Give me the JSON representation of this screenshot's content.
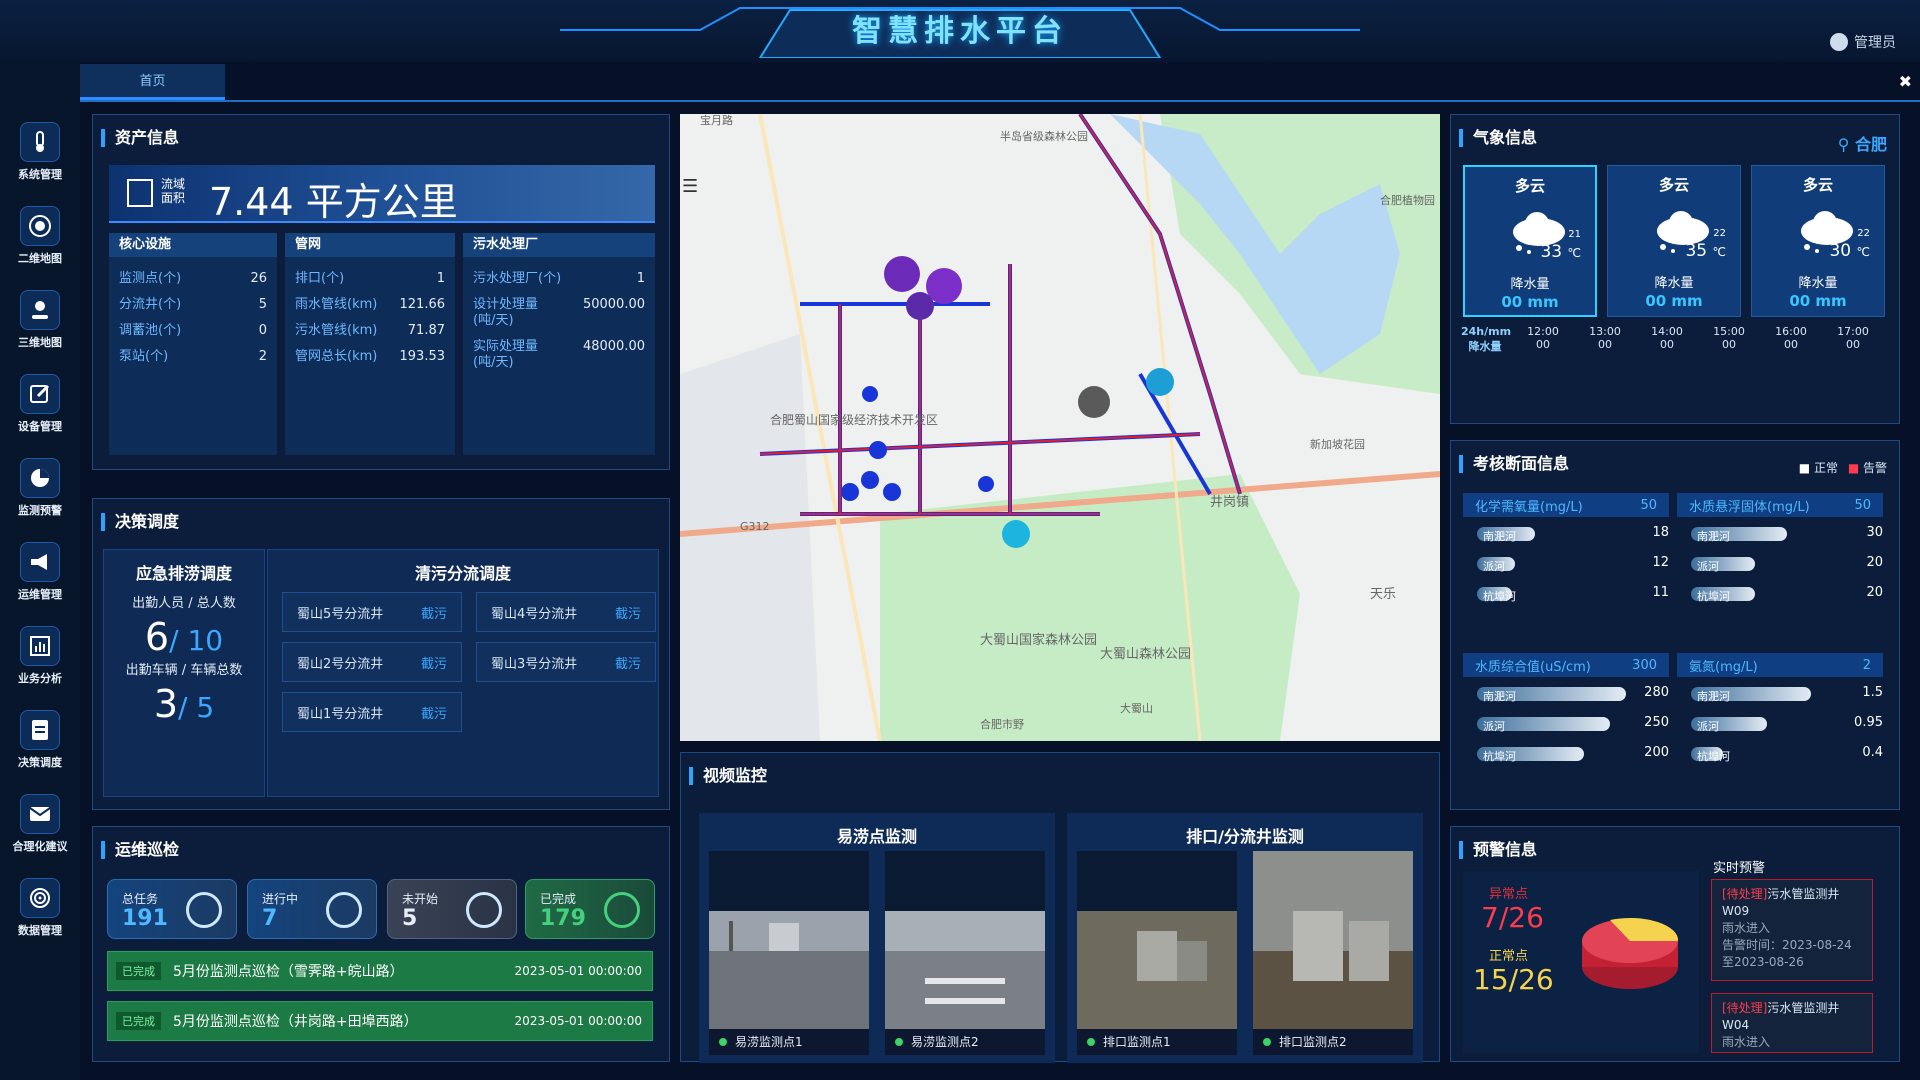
{
  "header": {
    "title": "智慧排水平台",
    "user": "管理员"
  },
  "tabs": [
    {
      "label": "首页"
    }
  ],
  "sidebar": {
    "items": [
      {
        "label": "系统管理",
        "icon": "thermometer-icon"
      },
      {
        "label": "二维地图",
        "icon": "map-circle-icon"
      },
      {
        "label": "三维地图",
        "icon": "pin-icon"
      },
      {
        "label": "设备管理",
        "icon": "edit-icon"
      },
      {
        "label": "监测预警",
        "icon": "pie-icon"
      },
      {
        "label": "运维管理",
        "icon": "megaphone-icon"
      },
      {
        "label": "业务分析",
        "icon": "bar-chart-icon"
      },
      {
        "label": "决策调度",
        "icon": "document-icon"
      },
      {
        "label": "合理化建议",
        "icon": "mail-icon"
      },
      {
        "label": "数据管理",
        "icon": "fingerprint-icon"
      }
    ]
  },
  "asset": {
    "title": "资产信息",
    "area_label_1": "流域",
    "area_label_2": "面积",
    "area_value": "7.44 平方公里",
    "core": {
      "head": "核心设施",
      "rows": [
        {
          "k": "监测点(个)",
          "v": "26"
        },
        {
          "k": "分流井(个)",
          "v": "5"
        },
        {
          "k": "调蓄池(个)",
          "v": "0"
        },
        {
          "k": "泵站(个)",
          "v": "2"
        }
      ]
    },
    "pipe": {
      "head": "管网",
      "rows": [
        {
          "k": "排口(个)",
          "v": "1"
        },
        {
          "k": "雨水管线(km)",
          "v": "121.66"
        },
        {
          "k": "污水管线(km)",
          "v": "71.87"
        },
        {
          "k": "管网总长(km)",
          "v": "193.53"
        }
      ]
    },
    "plant": {
      "head": "污水处理厂",
      "rows": [
        {
          "k": "污水处理厂(个)",
          "v": "1"
        },
        {
          "k": "设计处理量(吨/天)",
          "v": "50000.00"
        },
        {
          "k": "实际处理量(吨/天)",
          "v": "48000.00"
        }
      ]
    }
  },
  "decision": {
    "title": "决策调度",
    "emergency": {
      "head": "应急排涝调度",
      "staff_label": "出勤人员 / 总人数",
      "staff_on": "6",
      "staff_total": "/ 10",
      "car_label": "出勤车辆 / 车辆总数",
      "car_on": "3",
      "car_total": "/ 5"
    },
    "diversion": {
      "head": "清污分流调度",
      "items": [
        {
          "name": "蜀山5号分流井",
          "action": "截污"
        },
        {
          "name": "蜀山4号分流井",
          "action": "截污"
        },
        {
          "name": "蜀山2号分流井",
          "action": "截污"
        },
        {
          "name": "蜀山3号分流井",
          "action": "截污"
        },
        {
          "name": "蜀山1号分流井",
          "action": "截污"
        }
      ]
    }
  },
  "inspection": {
    "title": "运维巡检",
    "stats": [
      {
        "label": "总任务",
        "value": "191"
      },
      {
        "label": "进行中",
        "value": "7"
      },
      {
        "label": "未开始",
        "value": "5"
      },
      {
        "label": "已完成",
        "value": "179"
      }
    ],
    "tasks": [
      {
        "status": "已完成",
        "name": "5月份监测点巡检（雪霁路+皖山路）",
        "date": "2023-05-01 00:00:00"
      },
      {
        "status": "已完成",
        "name": "5月份监测点巡检（井岗路+田埠西路）",
        "date": "2023-05-01 00:00:00"
      }
    ]
  },
  "map": {
    "labels": [
      "宝月路",
      "半岛省级森林公园",
      "合肥蜀山国家级经济技术开发区",
      "合肥植物园",
      "井岗镇",
      "天乐",
      "大蜀山国家森林公园",
      "大蜀山森林公园",
      "大蜀山",
      "G312",
      "新加坡花园",
      "合肥市野"
    ]
  },
  "weather": {
    "title": "气象信息",
    "city": "合肥",
    "cards": [
      {
        "desc": "多云",
        "low": "21",
        "high": "33",
        "unit": "℃",
        "rain_label": "降水量",
        "rain": "00 mm"
      },
      {
        "desc": "多云",
        "low": "22",
        "high": "35",
        "unit": "℃",
        "rain_label": "降水量",
        "rain": "00 mm"
      },
      {
        "desc": "多云",
        "low": "22",
        "high": "30",
        "unit": "℃",
        "rain_label": "降水量",
        "rain": "00 mm"
      }
    ],
    "hourly_head_1": "24h/mm",
    "hourly_head_2": "降水量",
    "hours": [
      {
        "t": "12:00",
        "v": "00"
      },
      {
        "t": "13:00",
        "v": "00"
      },
      {
        "t": "14:00",
        "v": "00"
      },
      {
        "t": "15:00",
        "v": "00"
      },
      {
        "t": "16:00",
        "v": "00"
      },
      {
        "t": "17:00",
        "v": "00"
      }
    ]
  },
  "quality": {
    "title": "考核断面信息",
    "legend_normal": "正常",
    "legend_alarm": "告警",
    "colors": {
      "normal": "#ffffff",
      "alarm": "#ff3b4e"
    },
    "blocks": [
      {
        "name": "化学需氧量(mg/L)",
        "max": "50",
        "rows": [
          {
            "river": "南淝河",
            "value": 18
          },
          {
            "river": "派河",
            "value": 12
          },
          {
            "river": "杭埠河",
            "value": 11
          }
        ]
      },
      {
        "name": "水质悬浮固体(mg/L)",
        "max": "50",
        "rows": [
          {
            "river": "南淝河",
            "value": 30
          },
          {
            "river": "派河",
            "value": 20
          },
          {
            "river": "杭埠河",
            "value": 20
          }
        ]
      },
      {
        "name": "水质综合值(uS/cm)",
        "max": "300",
        "rows": [
          {
            "river": "南淝河",
            "value": 280
          },
          {
            "river": "派河",
            "value": 250
          },
          {
            "river": "杭埠河",
            "value": 200
          }
        ]
      },
      {
        "name": "氨氮(mg/L)",
        "max": "2",
        "rows": [
          {
            "river": "南淝河",
            "value": 1.5
          },
          {
            "river": "派河",
            "value": 0.95
          },
          {
            "river": "杭埠河",
            "value": 0.4
          }
        ]
      }
    ]
  },
  "warning": {
    "title": "预警信息",
    "abnormal_label": "异常点",
    "abnormal": "7/26",
    "normal_label": "正常点",
    "normal": "15/26",
    "realtime_label": "实时预警",
    "alerts": [
      {
        "tag": "[待处理]",
        "title": "污水管监测井",
        "code": "W09",
        "desc": "雨水进入",
        "time": "告警时间：2023-08-24至2023-08-26"
      },
      {
        "tag": "[待处理]",
        "title": "污水管监测井",
        "code": "W04",
        "desc": "雨水进入",
        "time": ""
      }
    ]
  },
  "video": {
    "title": "视频监控",
    "groups": [
      {
        "head": "易涝点监测",
        "cams": [
          "易涝监测点1",
          "易涝监测点2"
        ]
      },
      {
        "head": "排口/分流井监测",
        "cams": [
          "排口监测点1",
          "排口监测点2"
        ]
      }
    ]
  }
}
